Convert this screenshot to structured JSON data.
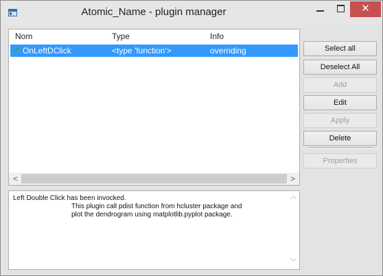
{
  "window": {
    "title": "Atomic_Name - plugin manager",
    "close_glyph": "✕"
  },
  "list": {
    "columns": [
      "Nom",
      "Type",
      "Info"
    ],
    "rows": [
      {
        "name": "OnLeftDClick",
        "type": "<type 'function'>",
        "info": "overriding",
        "checked": true,
        "selected": true
      }
    ],
    "scroll_left": "<",
    "scroll_right": ">"
  },
  "description": {
    "line1": "Left Double Click has been invocked.",
    "line2": "This plugin call pdist function from hcluster package and",
    "line3": "plot the dendrogram using matplotlib.pyplot package."
  },
  "buttons": {
    "select_all": "Select all",
    "deselect_all": "Deselect All",
    "add": "Add",
    "edit": "Edit",
    "apply": "Apply",
    "delete": "Delete",
    "properties": "Properties"
  },
  "colors": {
    "selection": "#3399ff",
    "close_button": "#c75050",
    "check": "#3aa657"
  }
}
